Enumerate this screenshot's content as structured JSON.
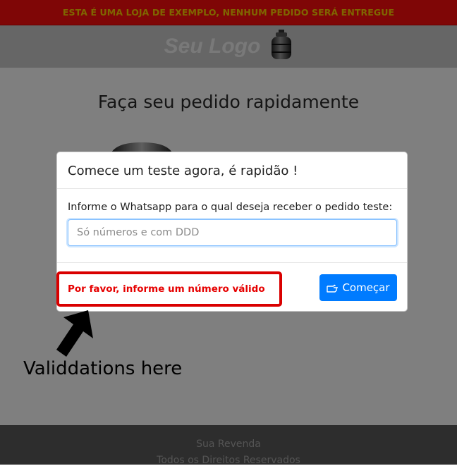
{
  "promo_banner": {
    "text": "ESTA É UMA LOJA DE EXEMPLO, NENHUM PEDIDO SERÁ ENTREGUE"
  },
  "header": {
    "logo_text": "Seu Logo",
    "logo_icon": "gas-cylinder-icon"
  },
  "main": {
    "headline": "Faça seu pedido rapidamente",
    "hero_icon": "gas-cylinder-icon"
  },
  "modal": {
    "title": "Comece um teste agora, é rapidão !",
    "field_label": "Informe o Whatsapp para o qual deseja receber o pedido teste:",
    "input_value": "",
    "input_placeholder": "Só números e com DDD",
    "validation_message": "Por favor, informe um número válido",
    "start_button_label": "Começar",
    "start_button_icon": "hand-pointer-icon"
  },
  "annotation": {
    "text": "Validdations here",
    "arrow_icon": "arrow-up-icon"
  },
  "footer": {
    "line1": "Sua Revenda",
    "line2": "Todos os Direitos Reservados"
  },
  "colors": {
    "banner_bg": "#ff0d0d",
    "banner_text": "#ffcd00",
    "primary_button": "#007bff",
    "validation_text": "#e60000",
    "annotation_border": "#d90000"
  }
}
